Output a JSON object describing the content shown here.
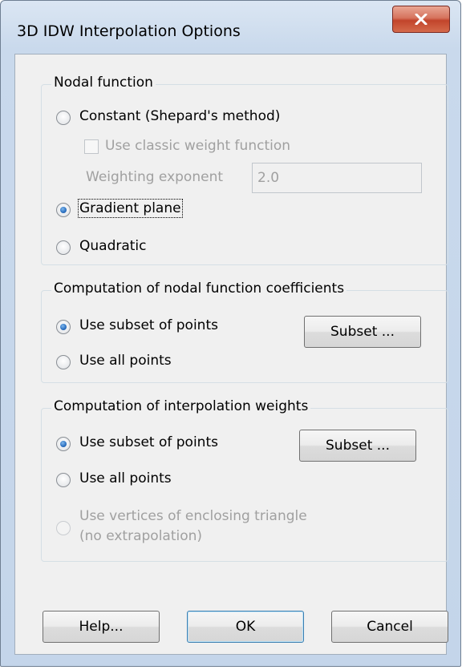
{
  "window": {
    "title": "3D IDW Interpolation Options",
    "close_glyph": "X"
  },
  "nodal": {
    "legend": "Nodal function",
    "constant_label": "Constant (Shepard's method)",
    "classic_weight_label": "Use classic weight function",
    "weighting_exponent_label": "Weighting exponent",
    "weighting_exponent_value": "2.0",
    "gradient_label": "Gradient plane",
    "quadratic_label": "Quadratic",
    "selected": "gradient_plane"
  },
  "coefficients": {
    "legend": "Computation of nodal function coefficients",
    "subset_label": "Use subset of points",
    "all_label": "Use all points",
    "subset_button": "Subset ...",
    "selected": "subset"
  },
  "weights": {
    "legend": "Computation of interpolation weights",
    "subset_label": "Use subset of points",
    "all_label": "Use all points",
    "triangle_label_line1": "Use vertices of enclosing triangle",
    "triangle_label_line2": "(no extrapolation)",
    "subset_button": "Subset ...",
    "selected": "subset"
  },
  "buttons": {
    "help": "Help...",
    "ok": "OK",
    "cancel": "Cancel"
  }
}
